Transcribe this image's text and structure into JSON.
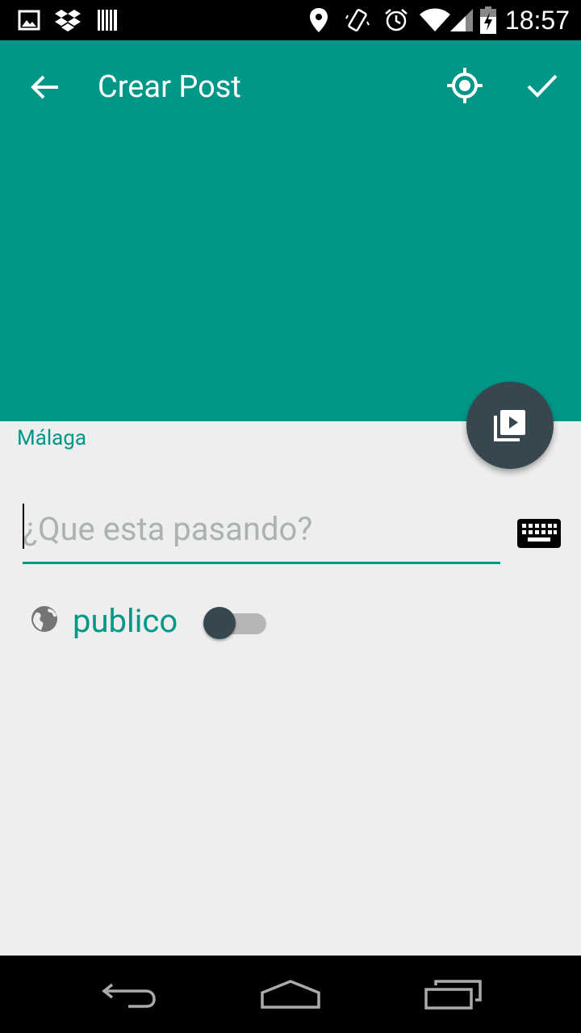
{
  "status_bar": {
    "time": "18:57",
    "icons": [
      "image-icon",
      "dropbox-icon",
      "barcode-icon",
      "location-pin-icon",
      "vibrate-icon",
      "alarm-icon",
      "wifi-icon",
      "signal-icon",
      "battery-charging-icon"
    ]
  },
  "app_bar": {
    "title": "Crear Post",
    "back_icon": "arrow-back-icon",
    "location_icon": "gps-fixed-icon",
    "confirm_icon": "check-icon",
    "color": "#009688"
  },
  "fab": {
    "icon": "video-library-icon",
    "color": "#37474f"
  },
  "location": {
    "text": "Málaga"
  },
  "post_input": {
    "value": "",
    "placeholder": "¿Que esta pasando?"
  },
  "keyboard_icon": "keyboard-icon",
  "visibility": {
    "icon": "globe-icon",
    "label": "publico",
    "toggle_on": false
  },
  "nav_bar": {
    "icons": [
      "back-nav-icon",
      "home-nav-icon",
      "recents-nav-icon"
    ]
  }
}
